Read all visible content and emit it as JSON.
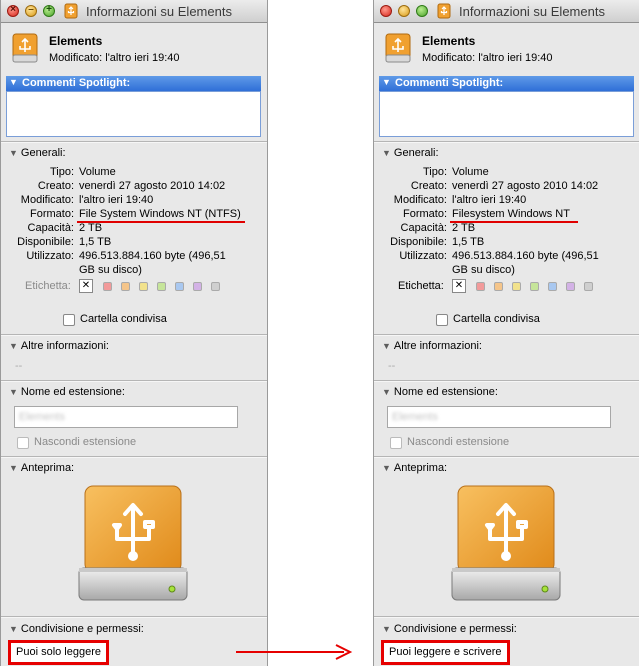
{
  "windows": [
    {
      "title": "Informazioni su Elements",
      "name": "Elements",
      "modified_header": "Modificato:  l'altro ieri 19:40",
      "spotlight_label": "Commenti Spotlight:",
      "general_label": "Generali:",
      "general": [
        {
          "key": "Tipo:",
          "value": "Volume"
        },
        {
          "key": "Creato:",
          "value": "venerdì 27 agosto 2010 14:02"
        },
        {
          "key": "Modificato:",
          "value": "l'altro ieri 19:40"
        },
        {
          "key": "Formato:",
          "value": "File System Windows NT (NTFS)"
        },
        {
          "key": "Capacità:",
          "value": "2 TB"
        },
        {
          "key": "Disponibile:",
          "value": "1,5 TB"
        },
        {
          "key": "Utilizzato:",
          "value": "496.513.884.160 byte (496,51"
        },
        {
          "key": "",
          "value": "GB su disco)"
        }
      ],
      "label_label": "Etichetta:",
      "label_x": "✕",
      "shared_folder": "Cartella condivisa",
      "more_info_label": "Altre informazioni:",
      "more_info_value": "--",
      "name_ext_label": "Nome ed estensione:",
      "name_field_value": "Elements",
      "hide_ext_label": "Nascondi estensione",
      "preview_label": "Anteprima:",
      "sharing_label": "Condivisione e permessi:",
      "permission": "Puoi solo leggere"
    },
    {
      "title": "Informazioni su Elements",
      "name": "Elements",
      "modified_header": "Modificato:  l'altro ieri 19:40",
      "spotlight_label": "Commenti Spotlight:",
      "general_label": "Generali:",
      "general": [
        {
          "key": "Tipo:",
          "value": "Volume"
        },
        {
          "key": "Creato:",
          "value": "venerdì 27 agosto 2010 14:02"
        },
        {
          "key": "Modificato:",
          "value": "l'altro ieri 19:40"
        },
        {
          "key": "Formato:",
          "value": "Filesystem Windows NT"
        },
        {
          "key": "Capacità:",
          "value": "2 TB"
        },
        {
          "key": "Disponibile:",
          "value": "1,5 TB"
        },
        {
          "key": "Utilizzato:",
          "value": "496.513.884.160 byte (496,51"
        },
        {
          "key": "",
          "value": "GB su disco)"
        }
      ],
      "label_label": "Etichetta:",
      "label_x": "✕",
      "shared_folder": "Cartella condivisa",
      "more_info_label": "Altre informazioni:",
      "more_info_value": "--",
      "name_ext_label": "Nome ed estensione:",
      "name_field_value": "Elements",
      "hide_ext_label": "Nascondi estensione",
      "preview_label": "Anteprima:",
      "sharing_label": "Condivisione e permessi:",
      "permission": "Puoi leggere e scrivere"
    }
  ],
  "colors": {
    "highlight": "#e60000",
    "spotlight_header": "#3b7ddd",
    "drive_orange": "#f0a030",
    "label_swatches": [
      "#f29a9a",
      "#f5c58a",
      "#f2e28c",
      "#c6e59a",
      "#a9c8f0",
      "#d3b2e6",
      "#cfcfcf"
    ]
  },
  "icons": {
    "window_title": "usb-drive-icon",
    "header": "usb-drive-icon",
    "preview": "usb-drive-icon",
    "transition": "arrow-right-icon"
  }
}
